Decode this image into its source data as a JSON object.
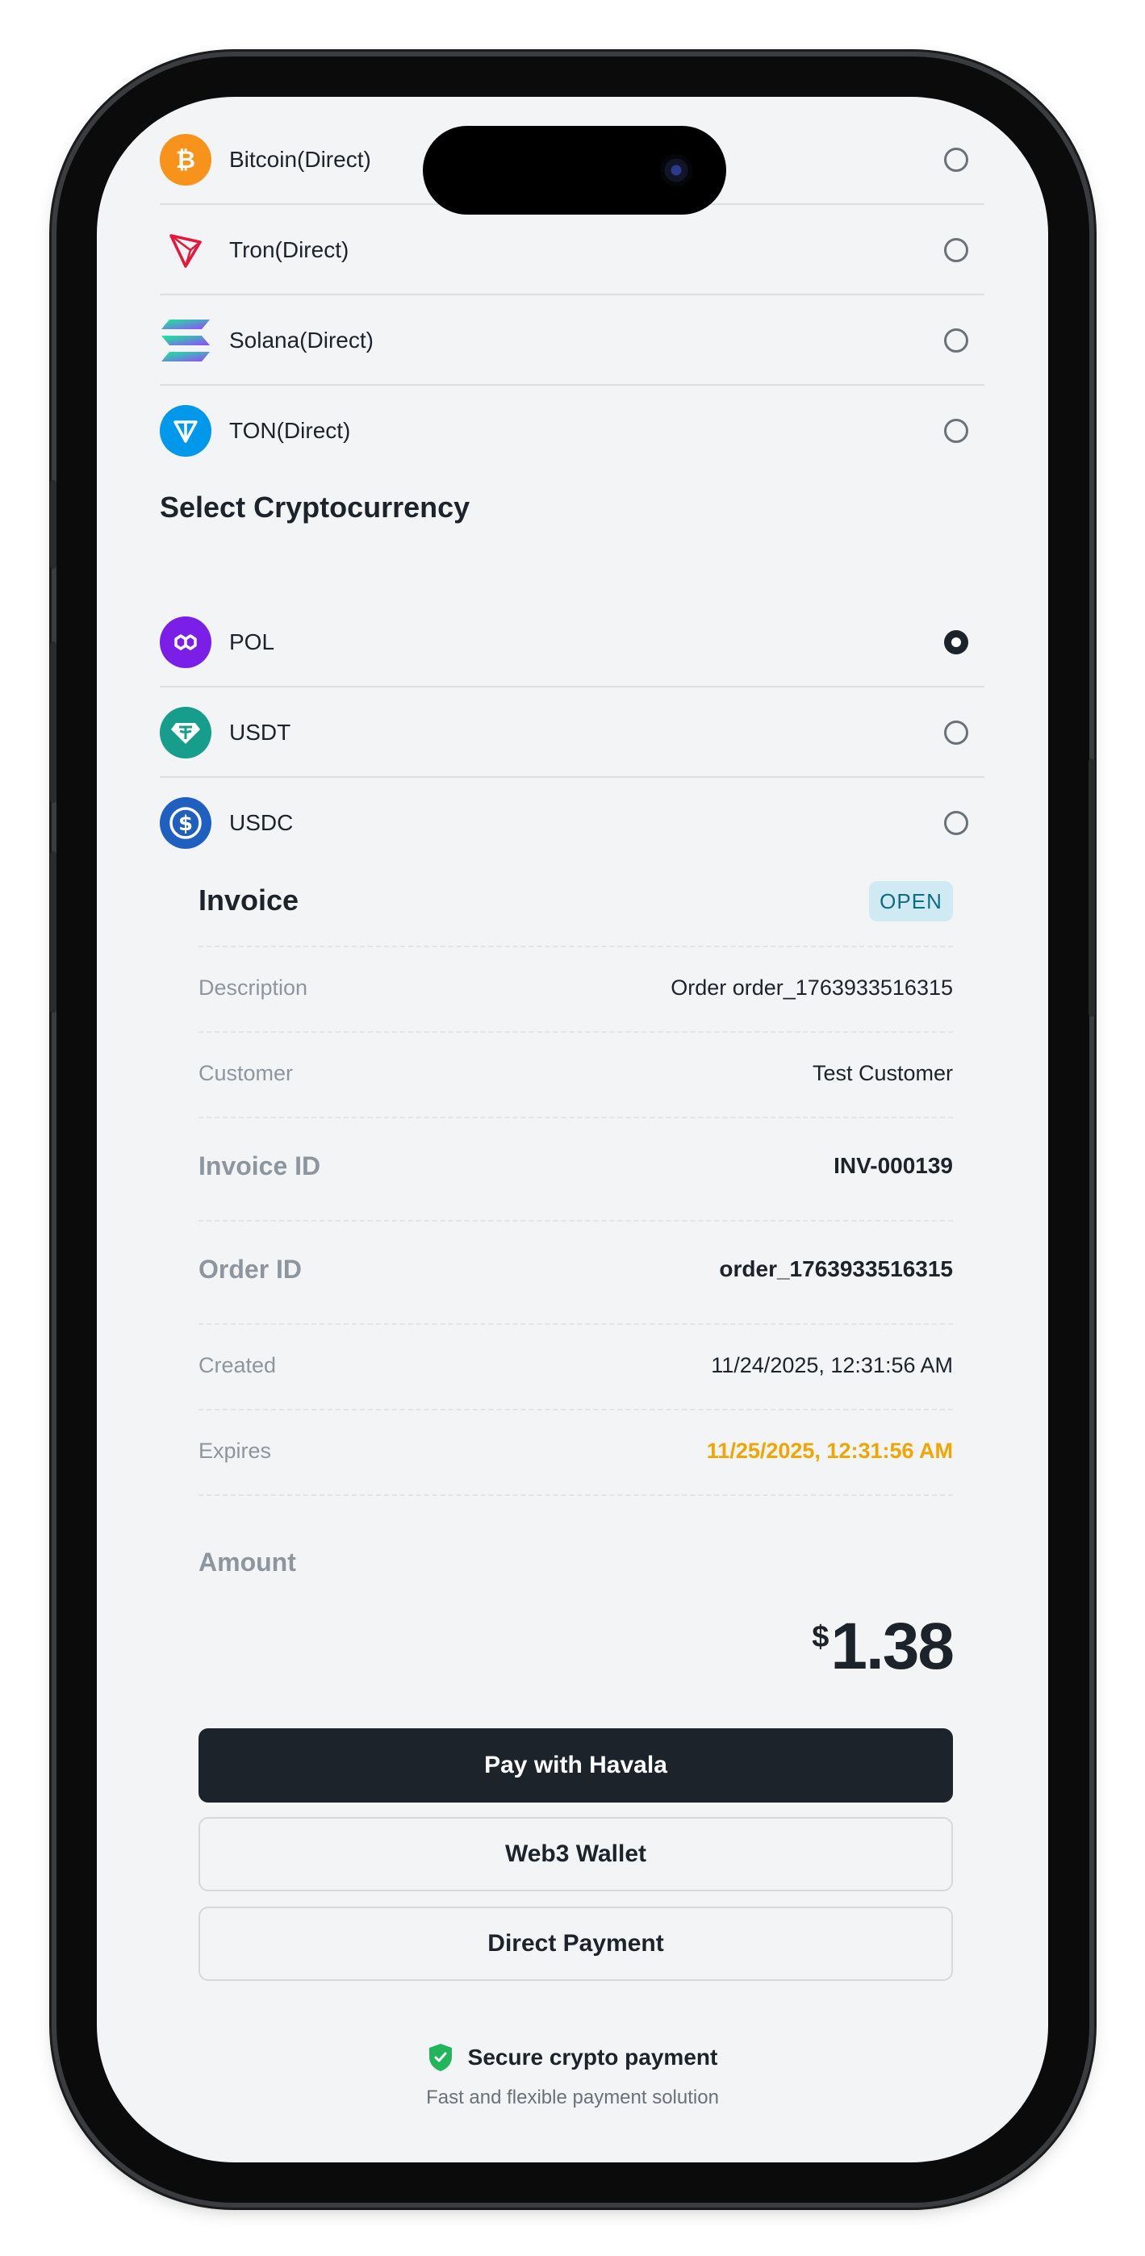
{
  "networks": [
    {
      "label": "Bitcoin(Direct)",
      "icon": "bitcoin-icon",
      "color": "#f7931a",
      "selected": false
    },
    {
      "label": "Tron(Direct)",
      "icon": "tron-icon",
      "color": "#e5173b",
      "selected": false
    },
    {
      "label": "Solana(Direct)",
      "icon": "solana-icon",
      "color": "#9945ff",
      "selected": false
    },
    {
      "label": "TON(Direct)",
      "icon": "ton-icon",
      "color": "#0098ea",
      "selected": false
    }
  ],
  "currency_section": {
    "title": "Select Cryptocurrency",
    "items": [
      {
        "label": "POL",
        "icon": "polygon-icon",
        "color": "#7b1fe8",
        "selected": true
      },
      {
        "label": "USDT",
        "icon": "tether-icon",
        "color": "#26a17b",
        "selected": false
      },
      {
        "label": "USDC",
        "icon": "usdc-icon",
        "color": "#2775ca",
        "selected": false
      }
    ]
  },
  "invoice": {
    "title": "Invoice",
    "status": "OPEN",
    "description_label": "Description",
    "description_value": "Order order_1763933516315",
    "customer_label": "Customer",
    "customer_value": "Test Customer",
    "invoice_id_label": "Invoice ID",
    "invoice_id_value": "INV-000139",
    "order_id_label": "Order ID",
    "order_id_value": "order_1763933516315",
    "created_label": "Created",
    "created_value": "11/24/2025, 12:31:56 AM",
    "expires_label": "Expires",
    "expires_value": "11/25/2025, 12:31:56 AM",
    "amount_label": "Amount",
    "amount_currency": "$",
    "amount_value": "1.38"
  },
  "actions": {
    "pay_havala": "Pay with Havala",
    "web3_wallet": "Web3 Wallet",
    "direct_payment": "Direct Payment"
  },
  "footer": {
    "secure_text": "Secure crypto payment",
    "tagline": "Fast and flexible payment solution"
  },
  "colors": {
    "accent_dark": "#1c232b",
    "warning": "#f0a500",
    "badge_bg": "#cfeaf2",
    "secure_green": "#22b55b"
  }
}
